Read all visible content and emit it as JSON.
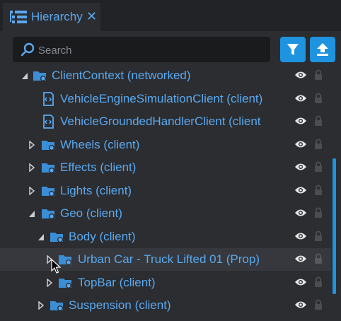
{
  "tab": {
    "title": "Hierarchy",
    "close": "✕",
    "icon": "hierarchy-list-icon"
  },
  "search": {
    "placeholder": "Search",
    "value": "",
    "icon": "search-icon"
  },
  "toolbar": {
    "filter_icon": "filter-icon",
    "upload_icon": "upload-icon"
  },
  "tree": {
    "rows": [
      {
        "label": "ClientContext (networked)",
        "icon": "networked-context-icon",
        "expander": "expanded"
      },
      {
        "label": "VehicleEngineSimulationClient (client)",
        "icon": "script-icon",
        "expander": "none"
      },
      {
        "label": "VehicleGroundedHandlerClient (client)",
        "icon": "script-icon",
        "expander": "none"
      },
      {
        "label": "Wheels (client)",
        "icon": "client-folder-icon",
        "expander": "collapsed"
      },
      {
        "label": "Effects (client)",
        "icon": "client-folder-icon",
        "expander": "collapsed"
      },
      {
        "label": "Lights (client)",
        "icon": "client-folder-icon",
        "expander": "collapsed"
      },
      {
        "label": "Geo (client)",
        "icon": "client-folder-icon",
        "expander": "expanded"
      },
      {
        "label": "Body (client)",
        "icon": "client-folder-icon",
        "expander": "expanded"
      },
      {
        "label": "Urban Car - Truck Lifted 01 (Prop)",
        "icon": "client-folder-icon",
        "expander": "collapsed",
        "selected": true
      },
      {
        "label": "TopBar (client)",
        "icon": "client-folder-icon",
        "expander": "collapsed"
      },
      {
        "label": "Suspension (client)",
        "icon": "client-folder-icon",
        "expander": "collapsed"
      }
    ]
  },
  "colors": {
    "accent": "#1e93e0",
    "text": "#5aa9f0",
    "background": "#2b2d31",
    "search_bg": "#1a1b1d"
  }
}
